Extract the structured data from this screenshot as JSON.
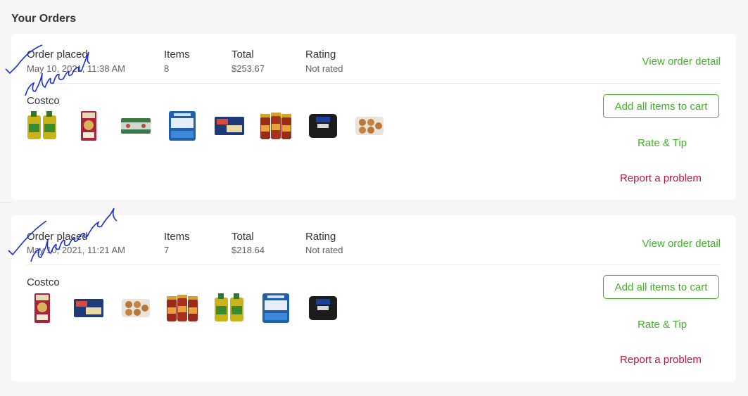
{
  "page": {
    "title": "Your Orders"
  },
  "labels": {
    "order_placed": "Order placed",
    "items": "Items",
    "total": "Total",
    "rating": "Rating"
  },
  "actions": {
    "view_detail": "View order detail",
    "add_all": "Add all items to cart",
    "rate_tip": "Rate & Tip",
    "report": "Report a problem"
  },
  "orders": [
    {
      "date": "May 10, 2021, 11:38 AM",
      "items": "8",
      "total": "$253.67",
      "rating": "Not rated",
      "store": "Costco",
      "annotation": "delivered",
      "products": [
        "olive-oil-2pack",
        "rice-bag",
        "canned-chicken-pack",
        "albacore-tuna-pack",
        "barilla-pasta-box",
        "pasta-sauce-3pack",
        "goya-beans-bag",
        "muffins-pack"
      ]
    },
    {
      "date": "May 10, 2021, 11:21 AM",
      "items": "7",
      "total": "$218.64",
      "rating": "Not rated",
      "store": "Costco",
      "annotation": "delivered",
      "products": [
        "rice-bag",
        "barilla-pasta-box",
        "muffins-pack",
        "pasta-sauce-3pack",
        "olive-oil-2pack",
        "albacore-tuna-pack",
        "goya-beans-bag"
      ]
    }
  ],
  "colors": {
    "green": "#43b02a",
    "red": "#c0143c",
    "ink": "#1a2fd6"
  }
}
